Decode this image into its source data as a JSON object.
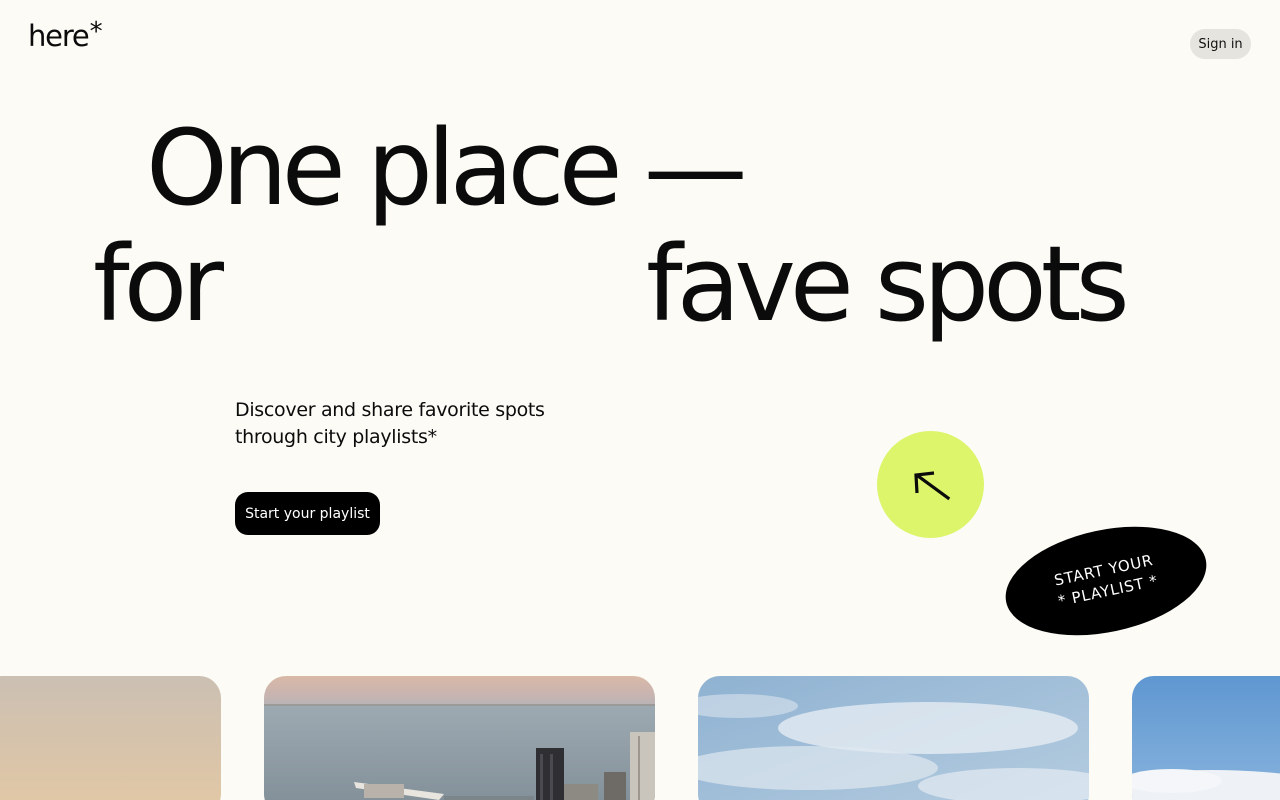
{
  "header": {
    "logo_text": "here",
    "logo_mark": "*",
    "sign_in_label": "Sign in"
  },
  "hero": {
    "line1": "One place —",
    "line2_left": "for",
    "line2_right": "fave spots",
    "subtitle_line1": "Discover and share favorite spots",
    "subtitle_line2": "through city playlists*",
    "cta_label": "Start your playlist"
  },
  "badge": {
    "line1": "START YOUR",
    "line2": "* PLAYLIST *"
  },
  "icons": {
    "arrow": "arrow-up-left-icon"
  },
  "colors": {
    "background": "#fcfbf6",
    "accent_lime": "#dcf56b",
    "button_dark": "#000000",
    "sign_in_bg": "#e6e4df"
  },
  "gallery": {
    "cards": [
      {
        "subject": "hazy-sky-photo"
      },
      {
        "subject": "city-harbor-photo"
      },
      {
        "subject": "cloudy-sky-photo"
      },
      {
        "subject": "sky-clouds-photo"
      }
    ]
  }
}
